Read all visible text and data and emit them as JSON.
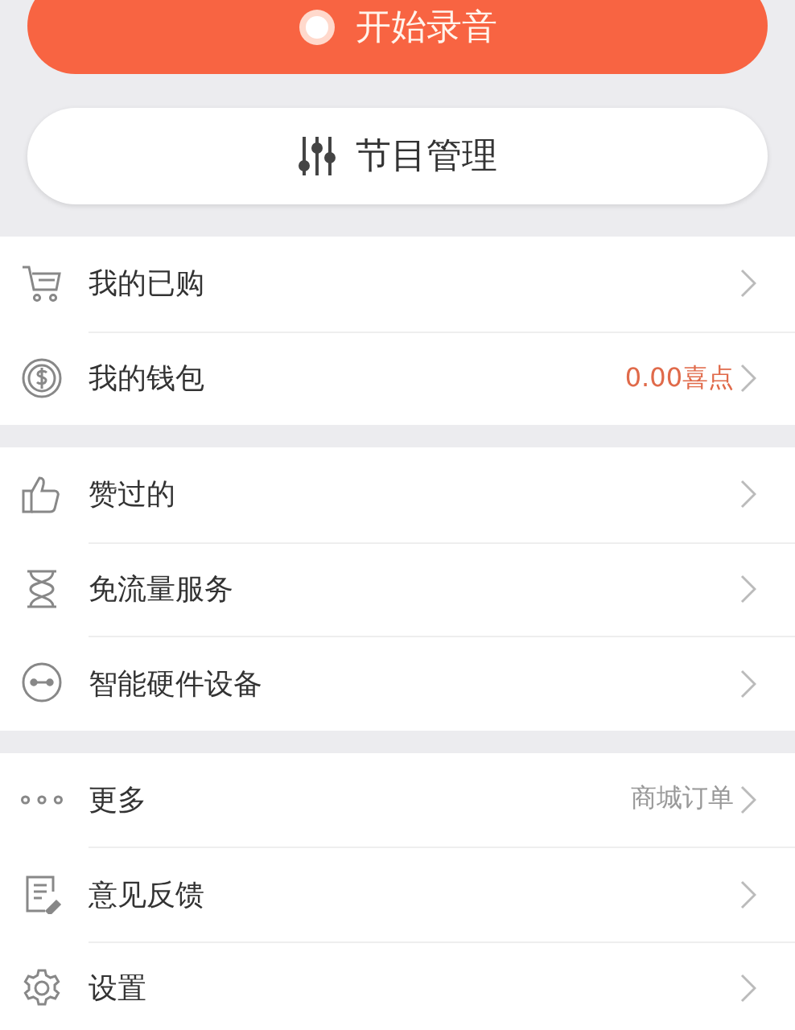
{
  "record_button": {
    "label": "开始录音"
  },
  "manage_button": {
    "label": "节目管理"
  },
  "sections": [
    {
      "rows": [
        {
          "label": "我的已购"
        },
        {
          "label": "我的钱包",
          "value": {
            "text": "0.00喜点",
            "kind": "highlight"
          }
        }
      ]
    },
    {
      "rows": [
        {
          "label": "赞过的"
        },
        {
          "label": "免流量服务"
        },
        {
          "label": "智能硬件设备"
        }
      ]
    },
    {
      "rows": [
        {
          "label": "更多",
          "value": {
            "text": "商城订单",
            "kind": "plain"
          }
        },
        {
          "label": "意见反馈"
        },
        {
          "label": "设置"
        }
      ]
    }
  ]
}
